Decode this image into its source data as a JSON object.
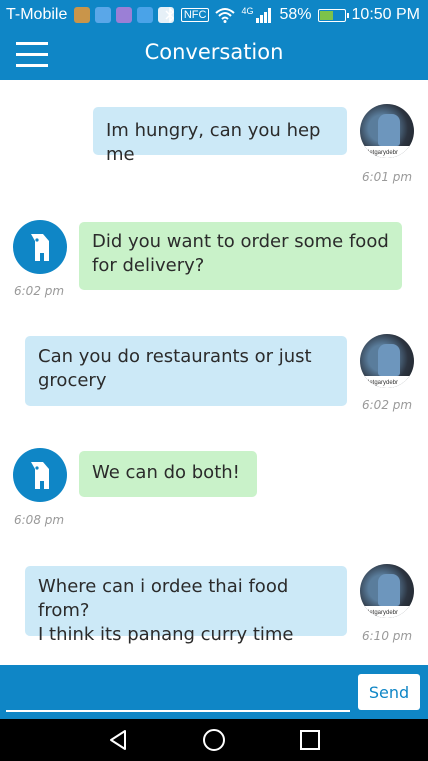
{
  "status_bar": {
    "carrier": "T-Mobile",
    "network": "4G",
    "battery": "58%",
    "battery_level": 0.58,
    "time": "10:50 PM"
  },
  "header": {
    "title": "Conversation",
    "menu_icon": "hamburger-menu-icon"
  },
  "messages": [
    {
      "sender": "user",
      "text": "Im hungry, can you hep me",
      "time": "6:01 pm"
    },
    {
      "sender": "bot",
      "lines": [
        "Did you want to order some food",
        "for delivery?"
      ],
      "time": "6:02 pm"
    },
    {
      "sender": "user",
      "lines": [
        "Can you do restaurants or just",
        "grocery"
      ],
      "time": "6:02 pm"
    },
    {
      "sender": "bot",
      "text": "We can do both!",
      "time": "6:08 pm"
    },
    {
      "sender": "user",
      "lines": [
        "Where can i ordee thai food from?",
        "I think its panang curry time"
      ],
      "time": "6:10 pm"
    }
  ],
  "avatar_watermark": "letgarydebr",
  "composer": {
    "value": "",
    "send_label": "Send"
  },
  "colors": {
    "brand_blue": "#0f86c6",
    "user_bubble": "#cce9f7",
    "bot_bubble": "#c9f2c9"
  },
  "nav": [
    "back-icon",
    "home-icon",
    "recents-icon"
  ]
}
